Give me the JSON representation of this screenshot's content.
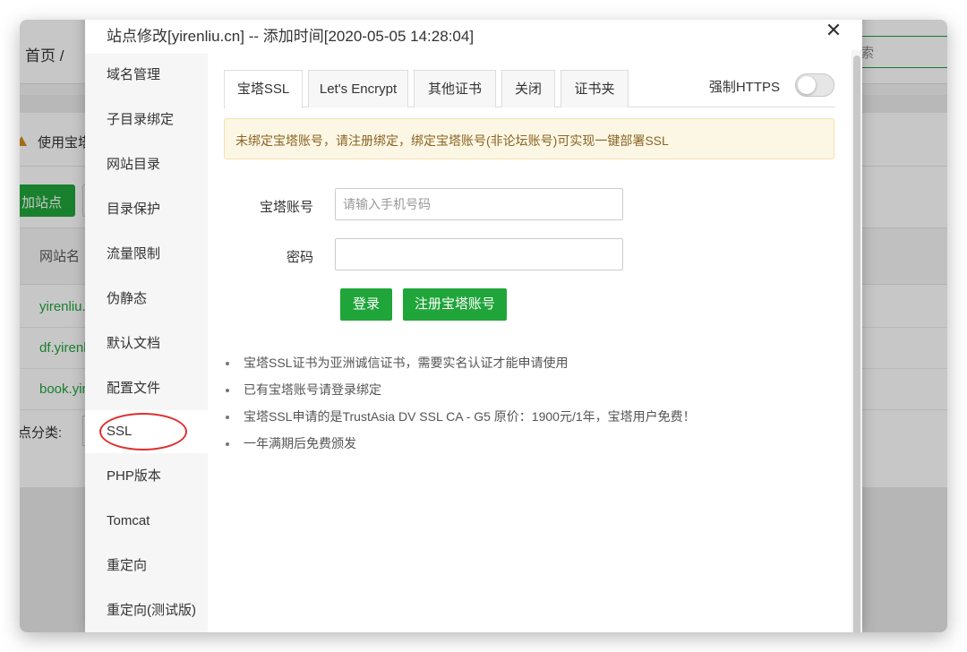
{
  "background": {
    "breadcrumb": "首页 / ",
    "search_placeholder": "搜索",
    "notice": "使用宝塔",
    "add_site_button": "加站点",
    "table_header": "网站名",
    "rows": [
      "yirenliu.",
      "df.yirenl",
      "book.yir"
    ],
    "category_label": "点分类:"
  },
  "modal": {
    "title": "站点修改[yirenliu.cn] -- 添加时间[2020-05-05 14:28:04]",
    "close": "✕",
    "sidebar": [
      "域名管理",
      "子目录绑定",
      "网站目录",
      "目录保护",
      "流量限制",
      "伪静态",
      "默认文档",
      "配置文件",
      "SSL",
      "PHP版本",
      "Tomcat",
      "重定向",
      "重定向(测试版)"
    ],
    "tabs": [
      "宝塔SSL",
      "Let's Encrypt",
      "其他证书",
      "关闭",
      "证书夹"
    ],
    "force_https_label": "强制HTTPS",
    "force_https_enabled": false,
    "alert": "未绑定宝塔账号，请注册绑定，绑定宝塔账号(非论坛账号)可实现一键部署SSL",
    "account_label": "宝塔账号",
    "account_placeholder": "请输入手机号码",
    "password_label": "密码",
    "login_button": "登录",
    "register_button": "注册宝塔账号",
    "tips": [
      "宝塔SSL证书为亚洲诚信证书，需要实名认证才能申请使用",
      "已有宝塔账号请登录绑定",
      "宝塔SSL申请的是TrustAsia DV SSL CA - G5 原价：1900元/1年，宝塔用户免费！",
      "一年满期后免费颁发"
    ]
  },
  "colors": {
    "accent_green": "#20a53a",
    "alert_bg": "#fcf7e4",
    "alert_text": "#8a6425",
    "annotation_red": "#e02e2e"
  }
}
